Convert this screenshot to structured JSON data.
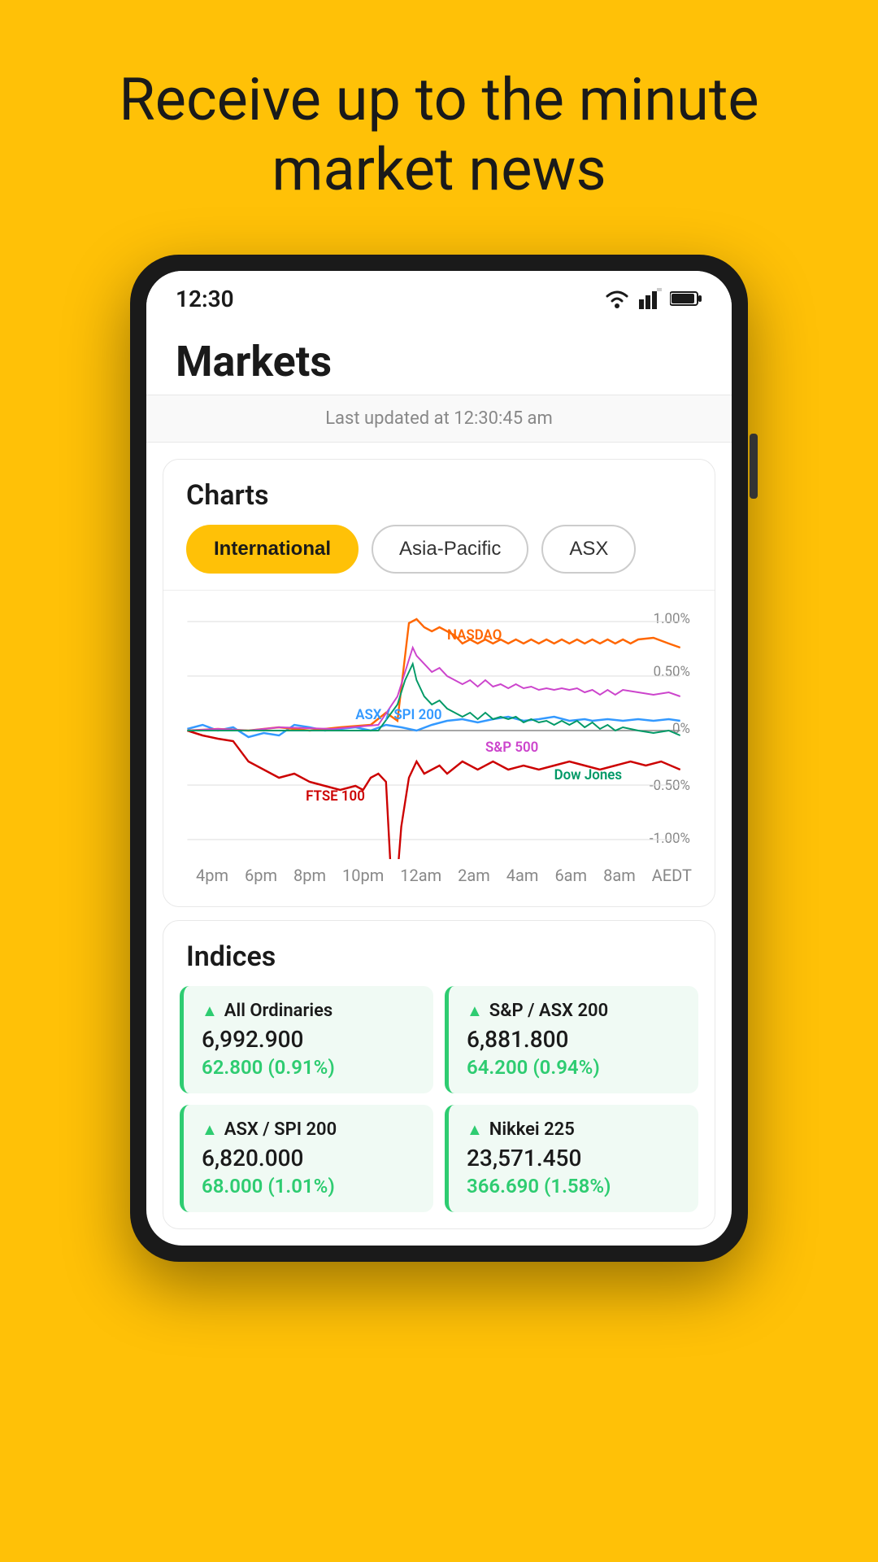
{
  "hero": {
    "text": "Receive up to the minute market news"
  },
  "status_bar": {
    "time": "12:30"
  },
  "header": {
    "title": "Markets",
    "last_updated": "Last updated at 12:30:45 am"
  },
  "charts": {
    "section_title": "Charts",
    "tabs": [
      {
        "label": "International",
        "active": true
      },
      {
        "label": "Asia-Pacific",
        "active": false
      },
      {
        "label": "ASX",
        "active": false
      }
    ],
    "x_labels": [
      "4pm",
      "6pm",
      "8pm",
      "10pm",
      "12am",
      "2am",
      "4am",
      "6am",
      "8am",
      "AEDT"
    ],
    "y_labels": [
      "1.00%",
      "0.50%",
      "0%",
      "-0.50%",
      "-1.00%"
    ],
    "series": [
      {
        "name": "ASX / SPI 200",
        "color": "#3399ff"
      },
      {
        "name": "NASDAQ",
        "color": "#ff6600"
      },
      {
        "name": "FTSE 100",
        "color": "#cc0000"
      },
      {
        "name": "S&P 500",
        "color": "#cc44cc"
      },
      {
        "name": "Dow Jones",
        "color": "#009966"
      }
    ]
  },
  "indices": {
    "section_title": "Indices",
    "items": [
      {
        "name": "All Ordinaries",
        "value": "6,992.900",
        "change": "62.800 (0.91%)",
        "up": true
      },
      {
        "name": "S&P / ASX 200",
        "value": "6,881.800",
        "change": "64.200 (0.94%)",
        "up": true
      },
      {
        "name": "ASX / SPI 200",
        "value": "6,820.000",
        "change": "68.000 (1.01%)",
        "up": true
      },
      {
        "name": "Nikkei 225",
        "value": "23,571.450",
        "change": "366.690 (1.58%)",
        "up": true
      }
    ]
  }
}
